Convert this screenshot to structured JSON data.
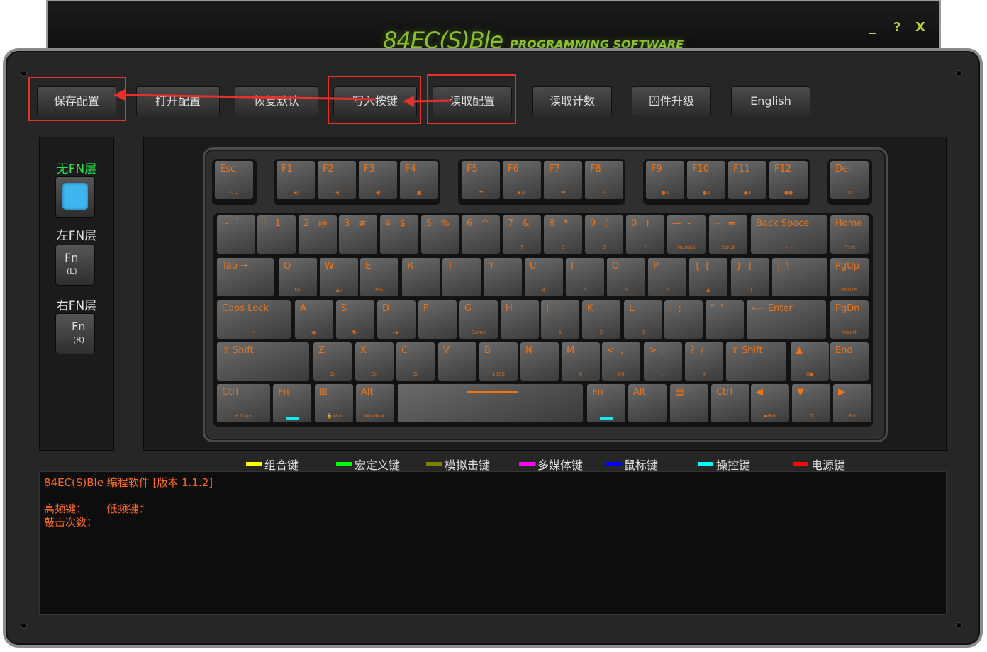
{
  "app": {
    "title_main": "84EC(S)Ble",
    "title_sub": "PROGRAMMING SOFTWARE",
    "window_controls": {
      "minimize": "_",
      "help": "?",
      "close": "X"
    }
  },
  "toolbar": [
    {
      "label": "保存配置"
    },
    {
      "label": "打开配置"
    },
    {
      "label": "恢复默认"
    },
    {
      "label": "写入按键"
    },
    {
      "label": "读取配置"
    },
    {
      "label": "读取计数"
    },
    {
      "label": "固件升级"
    },
    {
      "label": "English"
    }
  ],
  "layers": {
    "none": {
      "label": "无FN层",
      "color": "#2be050",
      "button_color": "#3fb6f0"
    },
    "left": {
      "label": "左FN层",
      "key_main": "Fn",
      "key_sub": "(L)"
    },
    "right": {
      "label": "右FN层",
      "key_main": "Fn",
      "key_sub": "(R)"
    }
  },
  "keyboard": {
    "legend_color": "#f07414",
    "indicator_color": "#19e6ef",
    "rows": [
      [
        {
          "label": "Esc",
          "sub": "↖ ♫"
        },
        {
          "label": "F1",
          "sub": "◀)"
        },
        {
          "label": "F2",
          "sub": "◀"
        },
        {
          "label": "F3",
          "sub": "◀)"
        },
        {
          "label": "F4",
          "sub": "■"
        },
        {
          "label": "F5",
          "sub": "⏮"
        },
        {
          "label": "F6",
          "sub": "▶/II"
        },
        {
          "label": "F7",
          "sub": "⏭"
        },
        {
          "label": "F8",
          "sub": "i"
        },
        {
          "label": "F9",
          "sub": "●1"
        },
        {
          "label": "F10",
          "sub": "●2"
        },
        {
          "label": "F11",
          "sub": "●3"
        },
        {
          "label": "F12",
          "sub": "●●"
        },
        {
          "label": "Del",
          "sub": "⊙"
        }
      ],
      [
        {
          "label": "~  `"
        },
        {
          "label": "!   1"
        },
        {
          "label": "2   @"
        },
        {
          "label": "3   #"
        },
        {
          "label": "4   $"
        },
        {
          "label": "5   %"
        },
        {
          "label": "6   ^"
        },
        {
          "label": "7   &",
          "sub": "7"
        },
        {
          "label": "8   *",
          "sub": "8"
        },
        {
          "label": "9   (",
          "sub": "9"
        },
        {
          "label": "0   )",
          "sub": "/"
        },
        {
          "label": "—  -",
          "sub": "NumLk"
        },
        {
          "label": "+  =",
          "sub": "ScrLk"
        },
        {
          "label": "Back Space",
          "sub": "⟵"
        },
        {
          "label": "Home",
          "sub": "Prtsc"
        }
      ],
      [
        {
          "label": "Tab ⇥"
        },
        {
          "label": "Q",
          "sub": "Q▹"
        },
        {
          "label": "W",
          "sub": "▲▹"
        },
        {
          "label": "E",
          "sub": "Pu▹"
        },
        {
          "label": "R"
        },
        {
          "label": "T"
        },
        {
          "label": "Y"
        },
        {
          "label": "U",
          "sub": "4"
        },
        {
          "label": "I",
          "sub": "5"
        },
        {
          "label": "O",
          "sub": "6"
        },
        {
          "label": "P",
          "sub": "*"
        },
        {
          "label": "{  [",
          "sub": "▲"
        },
        {
          "label": "}  ]",
          "sub": "Q"
        },
        {
          "label": "|  \\"
        },
        {
          "label": "PgUp",
          "sub": "Pause"
        }
      ],
      [
        {
          "label": "Caps Lock",
          "sub": "•"
        },
        {
          "label": "A",
          "sub": "◀▹"
        },
        {
          "label": "S",
          "sub": "▼▹"
        },
        {
          "label": "D",
          "sub": "▹▶"
        },
        {
          "label": "F"
        },
        {
          "label": "G",
          "sub": "Game"
        },
        {
          "label": "H"
        },
        {
          "label": "J",
          "sub": "1"
        },
        {
          "label": "K",
          "sub": "2"
        },
        {
          "label": "L",
          "sub": "3"
        },
        {
          "label": ":  ;",
          "sub": "-"
        },
        {
          "label": "\"  '"
        },
        {
          "label": "⟵ Enter"
        },
        {
          "label": "PgDn",
          "sub": "Insert"
        }
      ],
      [
        {
          "label": "⇧ Shift"
        },
        {
          "label": "Z",
          "sub": "Q▹"
        },
        {
          "label": "X",
          "sub": "Q▹"
        },
        {
          "label": "C",
          "sub": "Q▹"
        },
        {
          "label": "V"
        },
        {
          "label": "B",
          "sub": "1000"
        },
        {
          "label": "N"
        },
        {
          "label": "M",
          "sub": "0"
        },
        {
          "label": "<  ,",
          "sub": "00"
        },
        {
          "label": ">  .",
          "sub": "."
        },
        {
          "label": "?  /",
          "sub": "+"
        },
        {
          "label": "⇧ Shift"
        },
        {
          "label": "▲",
          "sub": "Q▪"
        },
        {
          "label": "End"
        }
      ],
      [
        {
          "label": "Ctrl",
          "sub": "+ Caps"
        },
        {
          "label": "Fn",
          "led": true
        },
        {
          "label": "⊞",
          "sub": "🔒Win"
        },
        {
          "label": "Alt",
          "sub": "Win/Mac"
        },
        {
          "label": ""
        },
        {
          "label": "Fn",
          "led": true
        },
        {
          "label": "Alt"
        },
        {
          "label": "▤"
        },
        {
          "label": "Ctrl"
        },
        {
          "label": "◀",
          "sub": "◆Bat"
        },
        {
          "label": "▼",
          "sub": "Q"
        },
        {
          "label": "▶",
          "sub": "Bat"
        }
      ]
    ]
  },
  "legend": [
    {
      "label": "组合键",
      "color": "#ffff00"
    },
    {
      "label": "宏定义键",
      "color": "#00ff00"
    },
    {
      "label": "模拟击键",
      "color": "#808000"
    },
    {
      "label": "多媒体键",
      "color": "#ff00ff"
    },
    {
      "label": "鼠标键",
      "color": "#0000ff"
    },
    {
      "label": "操控键",
      "color": "#00ffff"
    },
    {
      "label": "电源键",
      "color": "#ff0000"
    }
  ],
  "console": {
    "line1": "84EC(S)Ble 编程软件 [版本 1.1.2]",
    "line2": "高频键：      低频键：",
    "line3": "敲击次数："
  }
}
